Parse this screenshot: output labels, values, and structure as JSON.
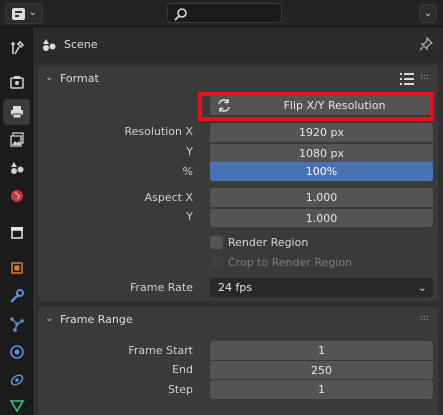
{
  "topbar": {
    "editor_type_icon": "properties-editor-icon",
    "search_placeholder": "",
    "options_icon": "chevron-down-icon"
  },
  "sidebar": {
    "tabs": [
      {
        "name": "tool",
        "icon": "wrench-screwdriver-icon",
        "active": false
      },
      {
        "name": "render",
        "icon": "camera-back-icon",
        "active": false
      },
      {
        "name": "output",
        "icon": "printer-icon",
        "active": true
      },
      {
        "name": "view-layer",
        "icon": "image-stack-icon",
        "active": false
      },
      {
        "name": "scene",
        "icon": "scene-icon",
        "active": false
      },
      {
        "name": "world",
        "icon": "globe-icon",
        "active": false
      },
      {
        "name": "collection",
        "icon": "box-icon",
        "active": false
      },
      {
        "name": "object",
        "icon": "object-icon",
        "active": false
      },
      {
        "name": "modifiers",
        "icon": "wrench-icon",
        "active": false
      },
      {
        "name": "particles",
        "icon": "particles-icon",
        "active": false
      },
      {
        "name": "physics",
        "icon": "physics-icon",
        "active": false
      },
      {
        "name": "constraints",
        "icon": "constraint-icon",
        "active": false
      },
      {
        "name": "data",
        "icon": "data-icon",
        "active": false
      }
    ]
  },
  "header": {
    "title": "Scene"
  },
  "format": {
    "title": "Format",
    "flip_button": "Flip X/Y Resolution",
    "resolution_x_label": "Resolution X",
    "resolution_x_value": "1920 px",
    "y_label": "Y",
    "resolution_y_value": "1080 px",
    "percent_label": "%",
    "percent_value": "100%",
    "aspect_x_label": "Aspect X",
    "aspect_x_value": "1.000",
    "aspect_y_label": "Y",
    "aspect_y_value": "1.000",
    "render_region_label": "Render Region",
    "render_region_checked": false,
    "crop_label": "Crop to Render Region",
    "crop_checked": false,
    "frame_rate_label": "Frame Rate",
    "frame_rate_value": "24 fps"
  },
  "frame_range": {
    "title": "Frame Range",
    "start_label": "Frame Start",
    "start_value": "1",
    "end_label": "End",
    "end_value": "250",
    "step_label": "Step",
    "step_value": "1"
  },
  "colors": {
    "accent": "#4772b3",
    "highlight": "#e8101a",
    "panel": "#303030",
    "field": "#545454"
  }
}
